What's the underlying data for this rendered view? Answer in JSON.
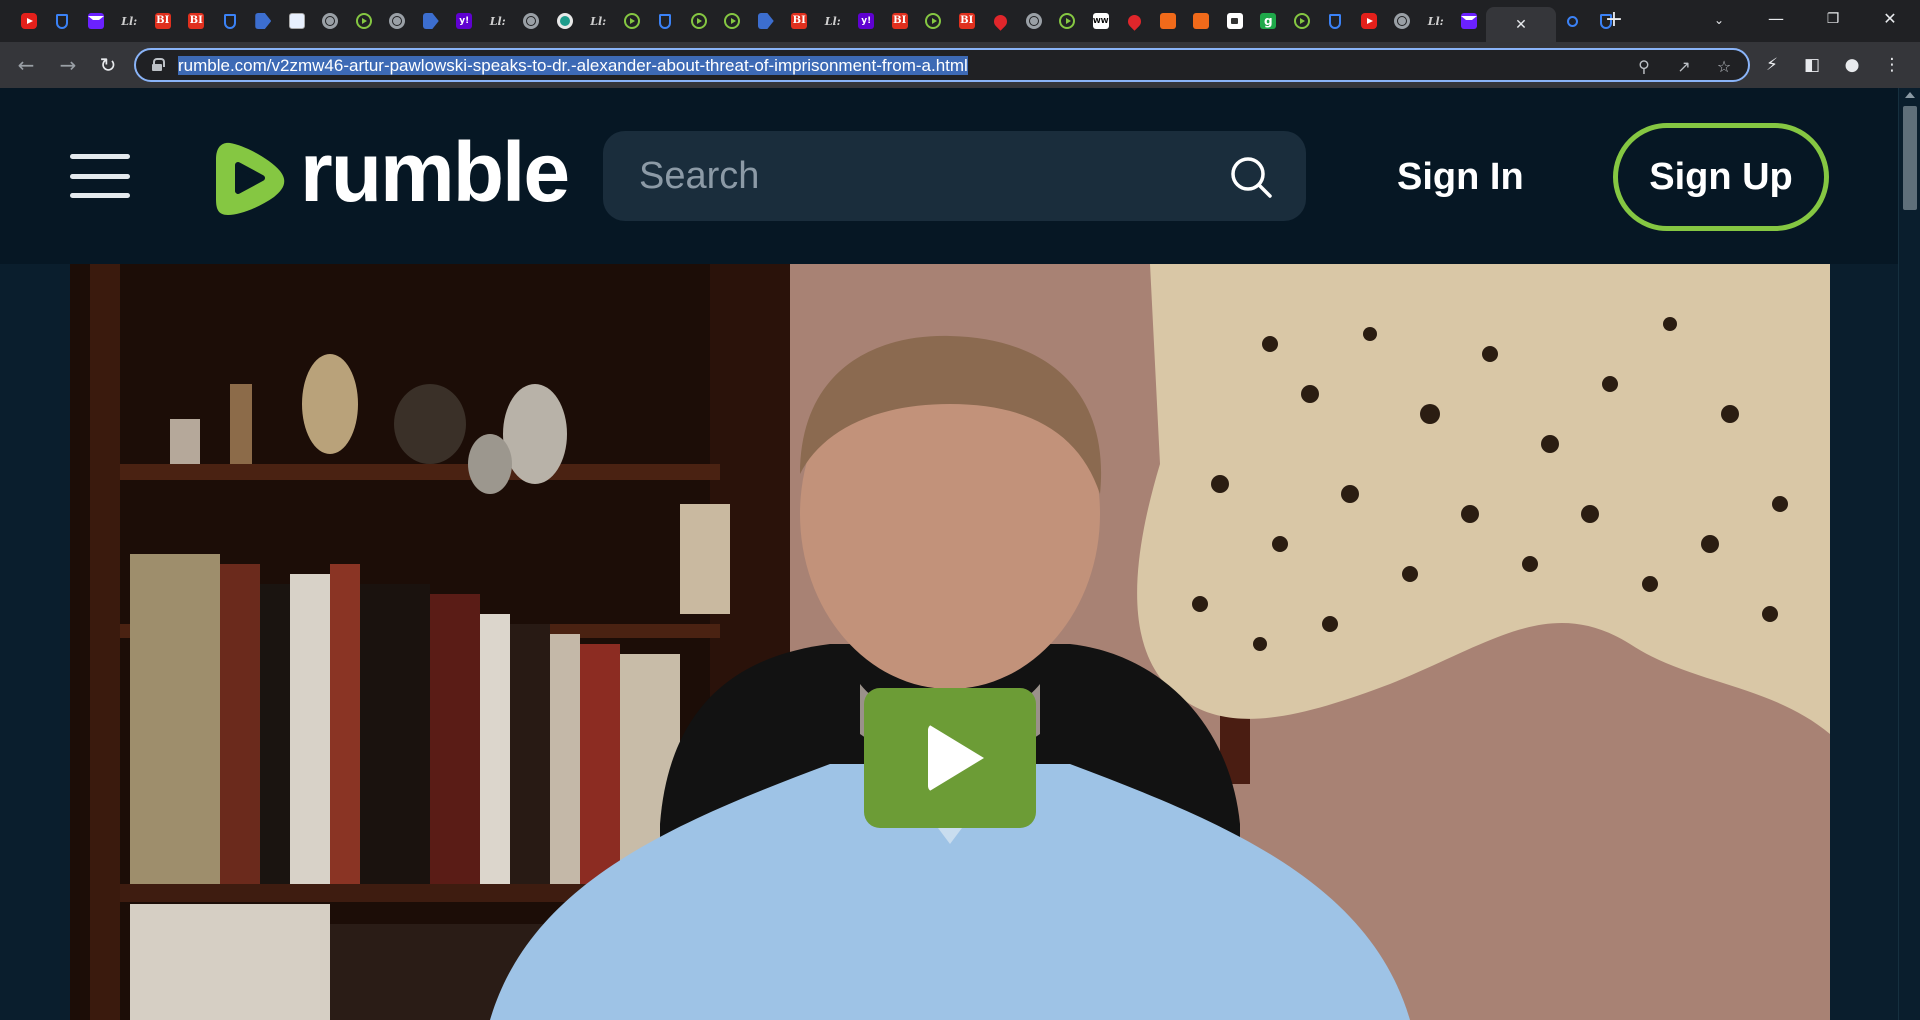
{
  "browser": {
    "tabs": [
      {
        "icon": "youtube-icon",
        "kind": "yt",
        "text": ""
      },
      {
        "icon": "shield-icon",
        "kind": "shield",
        "text": ""
      },
      {
        "icon": "mail-icon",
        "kind": "mail",
        "text": ""
      },
      {
        "icon": "wsj-icon",
        "kind": "wsj",
        "text": "Ll:"
      },
      {
        "icon": "business-insider-icon",
        "kind": "bi",
        "text": "BI"
      },
      {
        "icon": "business-insider-icon",
        "kind": "bi",
        "text": "BI"
      },
      {
        "icon": "shield-icon",
        "kind": "shield",
        "text": ""
      },
      {
        "icon": "arrow-icon",
        "kind": "arrow",
        "text": ""
      },
      {
        "icon": "map-icon",
        "kind": "map",
        "text": ""
      },
      {
        "icon": "globe-icon",
        "kind": "globe",
        "text": ""
      },
      {
        "icon": "rumble-icon",
        "kind": "rumble",
        "text": ""
      },
      {
        "icon": "globe-icon",
        "kind": "globe",
        "text": ""
      },
      {
        "icon": "arrow-icon",
        "kind": "arrow",
        "text": ""
      },
      {
        "icon": "yahoo-icon",
        "kind": "yahoo",
        "text": "y!"
      },
      {
        "icon": "wsj-icon",
        "kind": "wsj",
        "text": "Ll:"
      },
      {
        "icon": "globe-icon",
        "kind": "globe",
        "text": ""
      },
      {
        "icon": "teal-globe-icon",
        "kind": "teal",
        "text": ""
      },
      {
        "icon": "wsj-icon",
        "kind": "wsj",
        "text": "Ll:"
      },
      {
        "icon": "rumble-icon",
        "kind": "rumble",
        "text": ""
      },
      {
        "icon": "shield-icon",
        "kind": "shield",
        "text": ""
      },
      {
        "icon": "rumble-icon",
        "kind": "rumble",
        "text": ""
      },
      {
        "icon": "rumble-icon",
        "kind": "rumble",
        "text": ""
      },
      {
        "icon": "arrow-icon",
        "kind": "arrow",
        "text": ""
      },
      {
        "icon": "business-insider-icon",
        "kind": "bi",
        "text": "BI"
      },
      {
        "icon": "wsj-icon",
        "kind": "wsj",
        "text": "Ll:"
      },
      {
        "icon": "yahoo-icon",
        "kind": "yahoo",
        "text": "y!"
      },
      {
        "icon": "business-insider-icon",
        "kind": "bi",
        "text": "BI"
      },
      {
        "icon": "rumble-icon",
        "kind": "rumble",
        "text": ""
      },
      {
        "icon": "business-insider-icon",
        "kind": "bi",
        "text": "BI"
      },
      {
        "icon": "pin-icon",
        "kind": "pin",
        "text": ""
      },
      {
        "icon": "globe-icon",
        "kind": "globe",
        "text": ""
      },
      {
        "icon": "rumble-icon",
        "kind": "rumble",
        "text": ""
      },
      {
        "icon": "ww-icon",
        "kind": "ww",
        "text": "WW"
      },
      {
        "icon": "pin-icon",
        "kind": "pin",
        "text": ""
      },
      {
        "icon": "book-icon",
        "kind": "book",
        "text": ""
      },
      {
        "icon": "book-icon",
        "kind": "book",
        "text": ""
      },
      {
        "icon": "lock-icon",
        "kind": "lock",
        "text": ""
      },
      {
        "icon": "g-icon",
        "kind": "g",
        "text": "g"
      },
      {
        "icon": "rumble-icon",
        "kind": "rumble",
        "text": ""
      },
      {
        "icon": "shield-icon",
        "kind": "shield",
        "text": ""
      },
      {
        "icon": "youtube-icon",
        "kind": "yt",
        "text": ""
      },
      {
        "icon": "globe-icon",
        "kind": "globe",
        "text": ""
      },
      {
        "icon": "wsj-icon",
        "kind": "wsj",
        "text": "Ll:"
      },
      {
        "icon": "mail-icon",
        "kind": "mail",
        "text": ""
      }
    ],
    "tail_tabs": [
      {
        "icon": "search-tab-icon",
        "kind": "search",
        "text": ""
      },
      {
        "icon": "shield-icon",
        "kind": "shield",
        "text": ""
      }
    ],
    "url_display": "rumble.com/v2zmw46-artur-pawlowski-speaks-to-dr.-alexander-about-threat-of-imprisonment-from-a.html"
  },
  "header": {
    "logo_text": "rumble",
    "search_placeholder": "Search",
    "signin_label": "Sign In",
    "signup_label": "Sign Up"
  },
  "colors": {
    "brand_green": "#85c742",
    "play_green": "#6c9c36",
    "page_bg": "#0a1e2d",
    "header_bg": "#061724"
  }
}
